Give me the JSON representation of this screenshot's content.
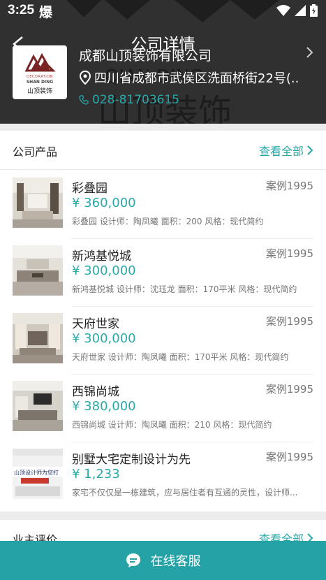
{
  "status": {
    "time": "3:25",
    "carrier": "爆"
  },
  "header": {
    "title": "公司详情"
  },
  "company": {
    "logo": {
      "line1": "DECORATION",
      "line2": "SHAN DING",
      "line3": "山顶装饰"
    },
    "name": "成都山顶装饰有限公司",
    "address": "四川省成都市武侯区洗面桥街22号(...",
    "phone": "028-81703615"
  },
  "products": {
    "title": "公司产品",
    "view_all": "查看全部",
    "items": [
      {
        "name": "彩叠园",
        "cases": "案例1995",
        "price": "¥ 360,000",
        "desc": "彩叠园 设计师：陶凤曦 面积：200 风格：现代简约"
      },
      {
        "name": "新鸿基悦城",
        "cases": "案例1995",
        "price": "¥ 300,000",
        "desc": "新鸿基悦城 设计师：沈珏龙 面积：170平米 风格：现代简约"
      },
      {
        "name": "天府世家",
        "cases": "案例1995",
        "price": "¥ 300,000",
        "desc": "天府世家 设计师：陶凤曦 面积：170平米 风格：现代简约"
      },
      {
        "name": "西锦尚城",
        "cases": "案例1995",
        "price": "¥ 380,000",
        "desc": "西锦尚城 设计师：陶凤曦 面积：210 风格：现代简约"
      },
      {
        "name": "别墅大宅定制设计为先",
        "cases": "案例1995",
        "price": "¥ 1,233",
        "desc": "家宅不仅仅是一栋建筑，应与居住者有互通的灵性，设计师..."
      }
    ],
    "promo_thumb_text": "山顶设计师为您打"
  },
  "reviews": {
    "title": "业主评价",
    "view_all": "查看全部"
  },
  "bottom": {
    "label": "在线客服"
  },
  "colors": {
    "accent": "#2aa9a9",
    "bar": "#25a2a6",
    "header_bg": "#303030"
  }
}
